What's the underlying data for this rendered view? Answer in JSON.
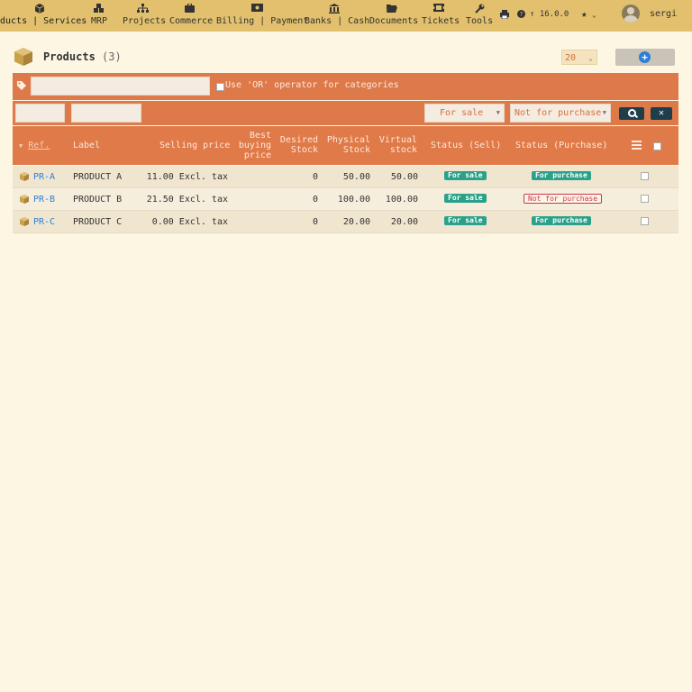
{
  "topnav": {
    "items": [
      {
        "label": "ducts | Services",
        "icon": "cube-icon"
      },
      {
        "label": "MRP",
        "icon": "cubes-icon"
      },
      {
        "label": "Projects",
        "icon": "sitemap-icon"
      },
      {
        "label": "Commerce",
        "icon": "briefcase-icon"
      },
      {
        "label": "Billing | Payment",
        "icon": "money-bill-icon"
      },
      {
        "label": "Banks | Cash",
        "icon": "bank-icon"
      },
      {
        "label": "Documents",
        "icon": "folder-open-icon"
      },
      {
        "label": "Tickets",
        "icon": "ticket-icon"
      },
      {
        "label": "Tools",
        "icon": "wrench-icon"
      }
    ],
    "version": "16.0.0",
    "user": "sergi"
  },
  "page": {
    "title": "Products",
    "count": "(3)",
    "limit": "20"
  },
  "filters": {
    "or_label": "Use 'OR' operator for categories",
    "sell_status": "For sale",
    "buy_status": "Not for purchase"
  },
  "table": {
    "headers": {
      "ref": "Ref.",
      "label": "Label",
      "price": "Selling price",
      "best_buy_1": "Best",
      "best_buy_2": "buying",
      "best_buy_3": "price",
      "desired_1": "Desired",
      "desired_2": "Stock",
      "physical_1": "Physical",
      "physical_2": "Stock",
      "virtual_1": "Virtual",
      "virtual_2": "stock",
      "status_sell": "Status (Sell)",
      "status_buy": "Status (Purchase)"
    },
    "rows": [
      {
        "ref": "PR-A",
        "label": "PRODUCT A",
        "price": "11.00 Excl. tax",
        "desired": "0",
        "physical": "50.00",
        "virtual": "50.00",
        "sell": "For sale",
        "buy": "For purchase"
      },
      {
        "ref": "PR-B",
        "label": "PRODUCT B",
        "price": "21.50 Excl. tax",
        "desired": "0",
        "physical": "100.00",
        "virtual": "100.00",
        "sell": "For sale",
        "buy": "Not for purchase"
      },
      {
        "ref": "PR-C",
        "label": "PRODUCT C",
        "price": "0.00 Excl. tax",
        "desired": "0",
        "physical": "20.00",
        "virtual": "20.00",
        "sell": "For sale",
        "buy": "For purchase"
      }
    ]
  }
}
